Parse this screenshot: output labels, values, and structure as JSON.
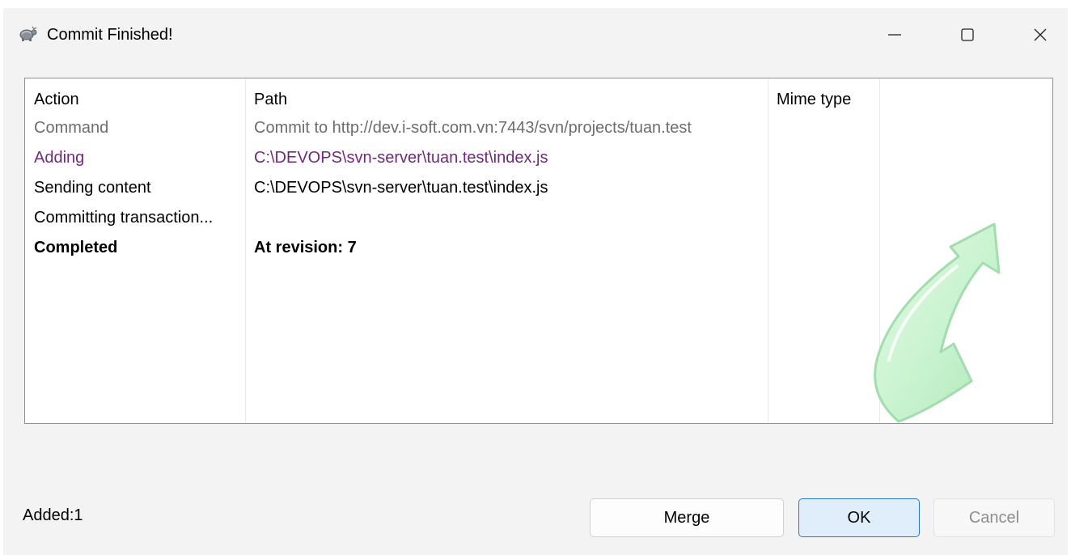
{
  "window": {
    "title": "Commit Finished!",
    "app_icon": "tortoise-icon",
    "controls": {
      "minimize_icon": "minimize-icon",
      "maximize_icon": "maximize-icon",
      "close_icon": "close-icon"
    }
  },
  "table": {
    "columns": [
      "Action",
      "Path",
      "Mime type"
    ],
    "rows": [
      {
        "action": "Command",
        "path": "Commit to http://dev.i-soft.com.vn:7443/svn/projects/tuan.test",
        "style": "gray"
      },
      {
        "action": "Adding",
        "path": "C:\\DEVOPS\\svn-server\\tuan.test\\index.js",
        "style": "purple"
      },
      {
        "action": "Sending content",
        "path": "C:\\DEVOPS\\svn-server\\tuan.test\\index.js",
        "style": "black"
      },
      {
        "action": "Committing transaction...",
        "path": "",
        "style": "black"
      },
      {
        "action": "Completed",
        "path": "At revision: 7",
        "style": "bold"
      }
    ],
    "watermark_icon": "commit-arrow-icon"
  },
  "footer": {
    "status": "Added:1",
    "buttons": {
      "merge": "Merge",
      "ok": "OK",
      "cancel": "Cancel"
    }
  },
  "colors": {
    "gray_text": "#6d6d6d",
    "purple_text": "#70287b",
    "ok_border": "#2d77c8",
    "ok_background": "#e0eefc"
  }
}
